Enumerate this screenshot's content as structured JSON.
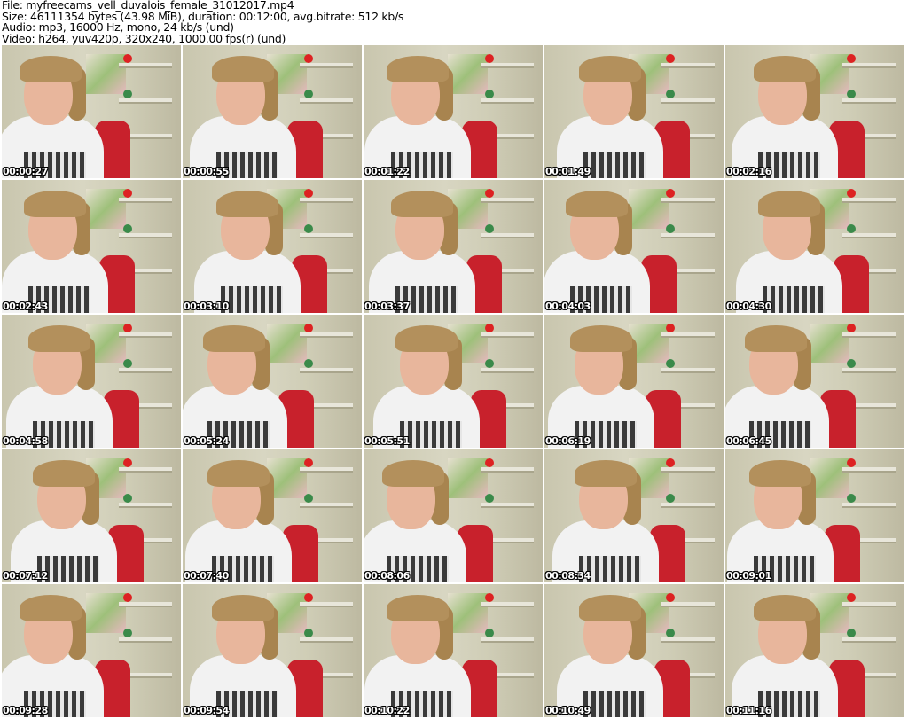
{
  "header": {
    "file": "File: myfreecams_vell_duvalois_female_31012017.mp4",
    "size": "Size: 46111354 bytes (43.98 MiB), duration: 00:12:00, avg.bitrate: 512 kb/s",
    "audio": "Audio: mp3, 16000 Hz, mono, 24 kb/s (und)",
    "video": "Video: h264, yuv420p, 320x240, 1000.00 fps(r) (und)"
  },
  "thumbnails": [
    "00:00:27",
    "00:00:55",
    "00:01:22",
    "00:01:49",
    "00:02:16",
    "00:02:43",
    "00:03:10",
    "00:03:37",
    "00:04:03",
    "00:04:30",
    "00:04:58",
    "00:05:24",
    "00:05:51",
    "00:06:19",
    "00:06:45",
    "00:07:12",
    "00:07:40",
    "00:08:06",
    "00:08:34",
    "00:09:01",
    "00:09:28",
    "00:09:54",
    "00:10:22",
    "00:10:49",
    "00:11:16"
  ]
}
